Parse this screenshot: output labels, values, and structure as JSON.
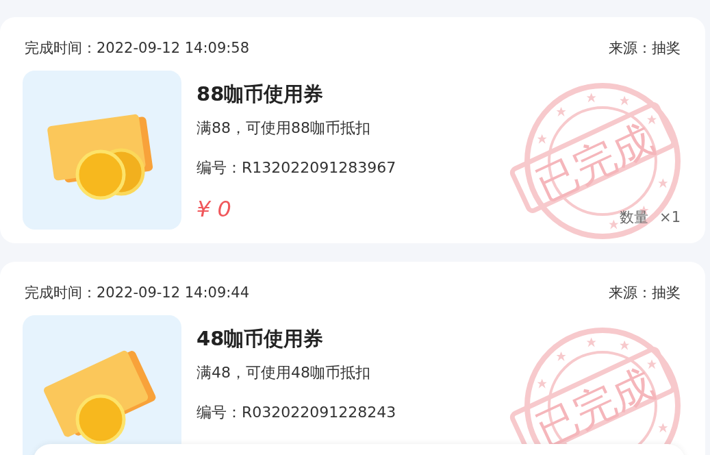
{
  "orders": [
    {
      "time_label": "完成时间：",
      "time": "2022-09-12 14:09:58",
      "source": "来源：抽奖",
      "title": "88咖币使用券",
      "condition": "满88，可使用88咖币抵扣",
      "number": "编号：R132022091283967",
      "price": "¥ 0",
      "quantity_label": "数量",
      "quantity": "×1",
      "stamp": "已完成"
    },
    {
      "time_label": "完成时间：",
      "time": "2022-09-12 14:09:44",
      "source": "来源：抽奖",
      "title": "48咖币使用券",
      "condition": "满48，可使用48咖币抵扣",
      "number": "编号：R032022091228243",
      "stamp": "已完成"
    }
  ]
}
